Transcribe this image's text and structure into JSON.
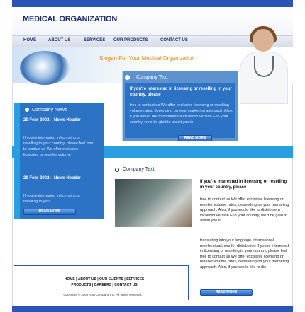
{
  "brand": {
    "title": "MEDICAL ORGANIZATION",
    "slogan": "Slogan For Your Medical Organization"
  },
  "nav": {
    "items": [
      "HOME",
      "ABOUT US",
      "SERVICES",
      "OUR PRODUCTS",
      "CONTACT US"
    ]
  },
  "company_text_box": {
    "title": "Company Text",
    "heading": "If you're interested in licensing or reselling  in your country, please",
    "body": "free to contact us We offer exclusive licensing or reselling volume rates, depending on your marketing approach. Also, if you would like to distribute a localized version E in your country, we'd be glad to assist you in",
    "button": "READ MORE"
  },
  "company_news": {
    "title": "Company News",
    "items": [
      {
        "date": "20 Febr 2002",
        "sep": " :: ",
        "label": "News Header",
        "text": "If you're interested in licensing or reselling  in your country, please feel free to contact us We offer exclusive licensing or reseller volume"
      },
      {
        "date": "20 Febr 2002",
        "sep": " :: ",
        "label": "News Header",
        "text": "If you're interested in licensing or reselling  in your"
      }
    ],
    "button": "READ MORE"
  },
  "company_text2": {
    "title": "Company Text",
    "heading": "If you're interested in licensing or reselling  in your country, please",
    "body1": "free to contact us We offer exclusive licensing or reseller volume rates, depending on your marketing approach. Also, if you would like to distribute a localized version E in your country, we'd be glad to assist you in",
    "body2": "translating  into your language.International resellers/partners for distribution If you're interested in licensing or reselling  in your country, please feel free to contact us We offer exclusive licensing or reseller volume rates, depending on your marketing approach. Also, if you would like to dis",
    "button": "READ MORE"
  },
  "footer": {
    "row1": "HOME   |   ABOUT US   |   OUR CLIENTS   |   SERVICES",
    "row2": "PRODUCTS   |   CAREERS   |   CONTACT US",
    "copyright": "Copyright © 2002 YourCompany Inc. All rights reserved."
  },
  "colors": {
    "accent_blue": "#2a55b6",
    "light_blue": "#2b9ee0",
    "orange": "#e98a1a"
  }
}
